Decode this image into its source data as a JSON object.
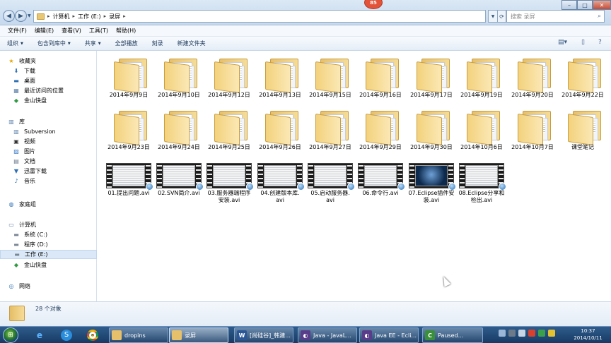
{
  "title_bar": {
    "breadcrumb": [
      "计算机",
      "工作 (E:)",
      "录屏"
    ],
    "search_placeholder": "搜索 录屏",
    "notification_badge": "85"
  },
  "menu": [
    "文件(F)",
    "编辑(E)",
    "查看(V)",
    "工具(T)",
    "帮助(H)"
  ],
  "toolbar": {
    "organize": "组织",
    "include_in_library": "包含到库中",
    "share": "共享",
    "play_all": "全部播放",
    "burn": "刻录",
    "new_folder": "新建文件夹"
  },
  "sidebar": {
    "favorites": "收藏夹",
    "favorite_items": [
      "下载",
      "桌面",
      "最近访问的位置",
      "金山快盘"
    ],
    "libraries": "库",
    "library_items": [
      "Subversion",
      "视频",
      "图片",
      "文档",
      "迅雷下载",
      "音乐"
    ],
    "homegroup": "家庭组",
    "computer": "计算机",
    "computer_items": [
      "系统 (C:)",
      "程序 (D:)",
      "工作 (E:)",
      "金山快盘"
    ],
    "network": "网络"
  },
  "folders_row1": [
    "2014年9月9日",
    "2014年9月10日",
    "2014年9月12日",
    "2014年9月13日",
    "2014年9月15日",
    "2014年9月16日",
    "2014年9月17日",
    "2014年9月19日",
    "2014年9月20日",
    "2014年9月22日"
  ],
  "folders_row2": [
    "2014年9月23日",
    "2014年9月24日",
    "2014年9月25日",
    "2014年9月26日",
    "2014年9月27日",
    "2014年9月29日",
    "2014年9月30日",
    "2014年10月6日",
    "2014年10月7日",
    "课堂笔记"
  ],
  "videos": [
    {
      "line1": "01.提出问题.avi",
      "line2": ""
    },
    {
      "line1": "02.SVN简介.avi",
      "line2": ""
    },
    {
      "line1": "03.服务器端程序",
      "line2": "安装.avi"
    },
    {
      "line1": "04.创建版本库.",
      "line2": "avi"
    },
    {
      "line1": "05.启动服务器.",
      "line2": "avi"
    },
    {
      "line1": "06.命令行.avi",
      "line2": ""
    },
    {
      "line1": "07.Eclipse插件安",
      "line2": "装.avi"
    },
    {
      "line1": "08.Eclipse分享和",
      "line2": "检出.avi"
    }
  ],
  "status": {
    "count": "28 个对象"
  },
  "taskbar": {
    "buttons": [
      {
        "label": "dropins",
        "icon": "folder-icon",
        "color": "#e7c06b"
      },
      {
        "label": "录屏",
        "icon": "folder-icon",
        "color": "#e7c06b"
      },
      {
        "label": "[尚硅谷]_韩建...",
        "icon": "word-icon",
        "color": "#2b5797"
      },
      {
        "label": "Java - JavaL...",
        "icon": "eclipse-icon",
        "color": "#5a3d8a"
      },
      {
        "label": "Java EE - Ecli...",
        "icon": "eclipse-icon",
        "color": "#5a3d8a"
      },
      {
        "label": "Paused...",
        "icon": "camtasia-icon",
        "color": "#3a8f3a"
      }
    ],
    "time": "10:37",
    "date": "2014/10/11"
  }
}
